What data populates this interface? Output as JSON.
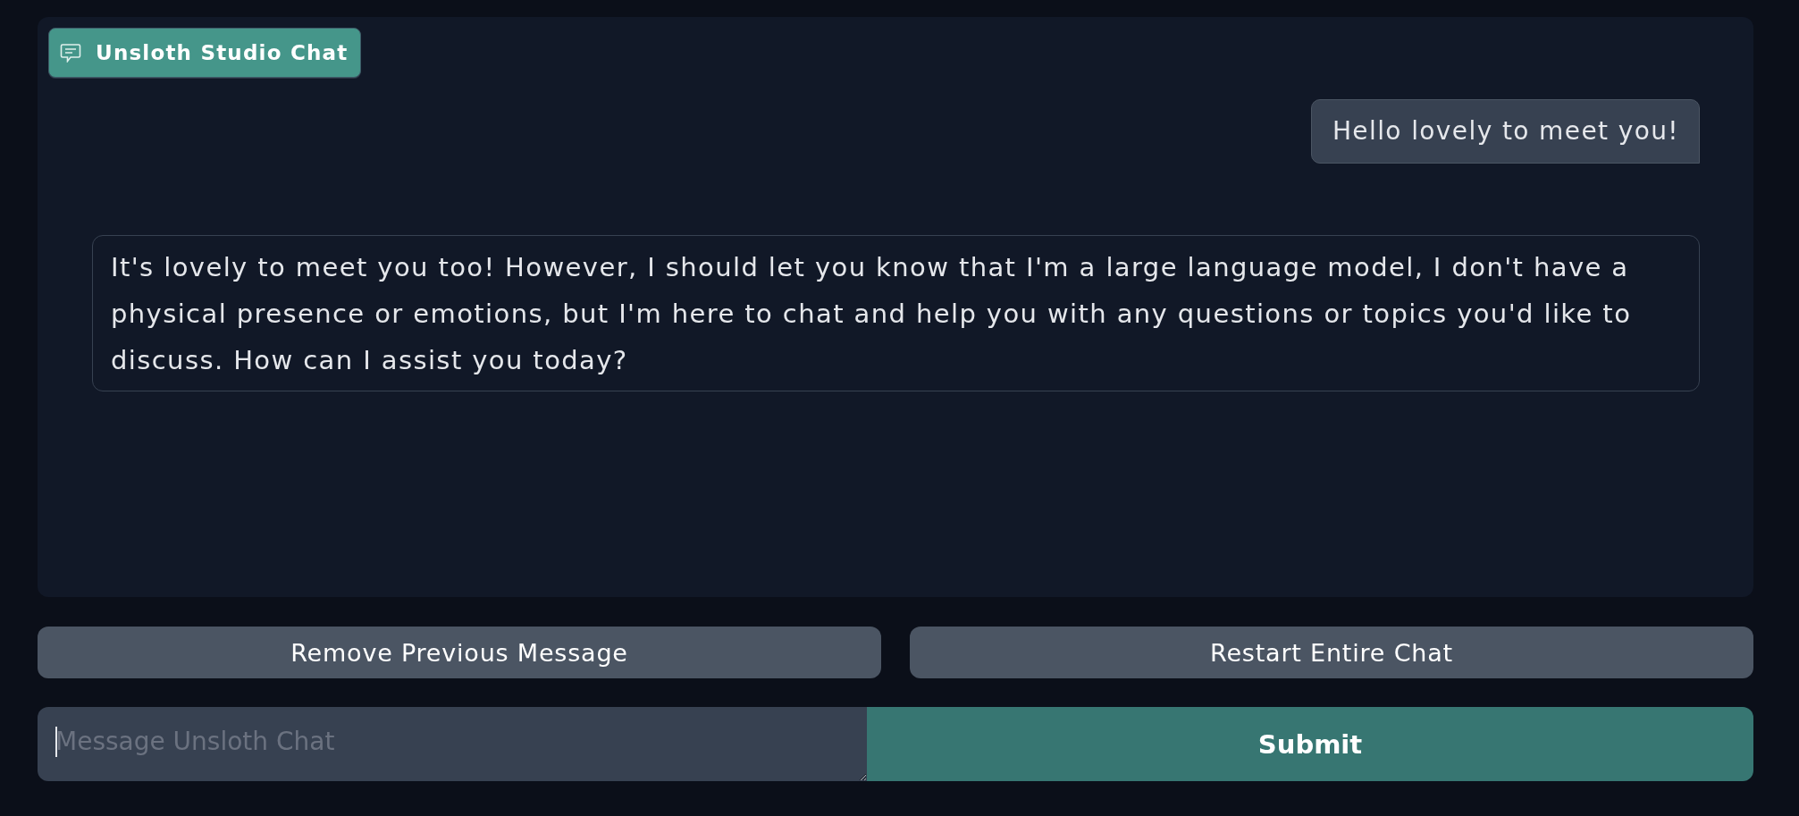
{
  "chat": {
    "label": "Unsloth Studio Chat",
    "messages": [
      {
        "kind": "user",
        "text": "Hello lovely to meet you!"
      },
      {
        "kind": "assistant",
        "text": "It's lovely to meet you too! However, I should let you know that I'm a large language model, I don't have a physical presence or emotions, but I'm here to chat and help you with any questions or topics you'd like to discuss. How can I assist you today?"
      }
    ]
  },
  "actions": [
    {
      "label": "Remove Previous Message"
    },
    {
      "label": "Restart Entire Chat"
    }
  ],
  "composer": {
    "placeholder": "Message Unsloth Chat",
    "submit": "Submit"
  }
}
